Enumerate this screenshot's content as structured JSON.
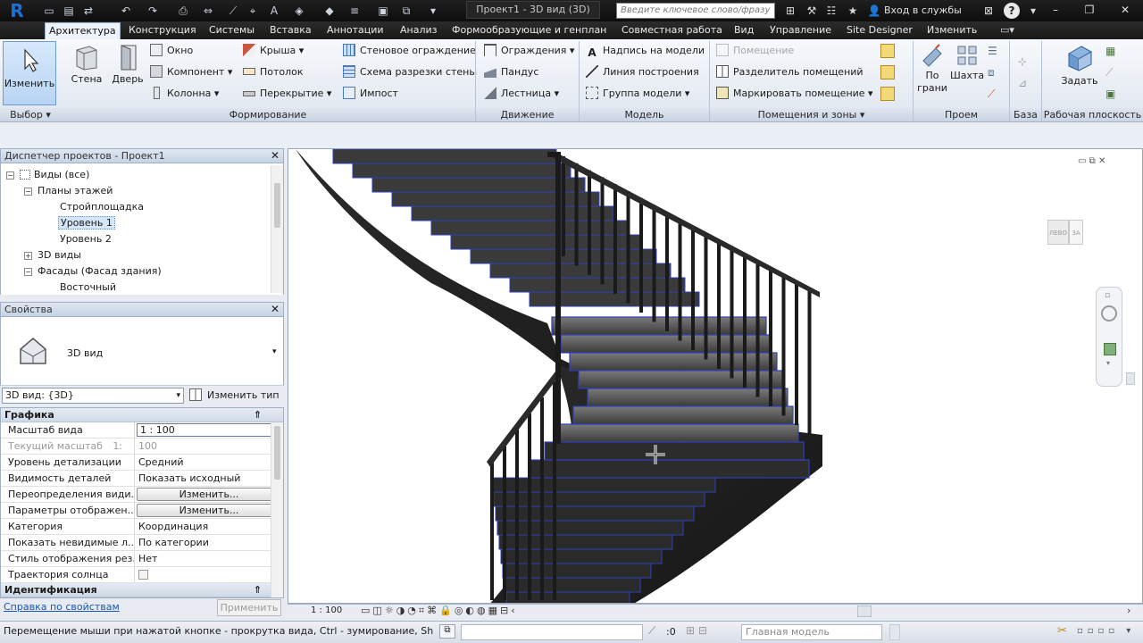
{
  "titlebar": {
    "app_logo": "R",
    "doc_title": "Проект1 - 3D вид (3D)",
    "search_placeholder": "Введите ключевое слово/фразу",
    "signin": "Вход в службы",
    "help": "?"
  },
  "tabs": [
    {
      "label": "Архитектура",
      "active": true
    },
    {
      "label": "Конструкция"
    },
    {
      "label": "Системы"
    },
    {
      "label": "Вставка"
    },
    {
      "label": "Аннотации"
    },
    {
      "label": "Анализ"
    },
    {
      "label": "Формообразующие и генплан"
    },
    {
      "label": "Совместная работа"
    },
    {
      "label": "Вид"
    },
    {
      "label": "Управление"
    },
    {
      "label": "Site Designer"
    },
    {
      "label": "Изменить"
    }
  ],
  "ribbon": {
    "modify": "Изменить",
    "wall": "Стена",
    "door": "Дверь",
    "window": "Окно",
    "component": "Компонент",
    "column": "Колонна",
    "roof": "Крыша",
    "ceiling": "Потолок",
    "floor": "Перекрытие",
    "curtain_system": "Стеновое ограждение",
    "curtain_grid": "Схема разрезки стены",
    "mullion": "Импост",
    "railing": "Ограждения",
    "ramp": "Пандус",
    "stair": "Лестница",
    "model_text": "Надпись на модели",
    "model_line": "Линия построения",
    "model_group": "Группа модели",
    "room": "Помещение",
    "room_separator": "Разделитель помещений",
    "tag_room": "Маркировать помещение",
    "by_face": "По\nграни",
    "shaft": "Шахта",
    "set": "Задать",
    "panels": {
      "select": "Выбор",
      "build": "Формирование",
      "circulation": "Движение",
      "model": "Модель",
      "room_area": "Помещения и зоны",
      "opening": "Проем",
      "datum": "База",
      "work_plane": "Рабочая плоскость"
    }
  },
  "project_browser": {
    "title": "Диспетчер проектов - Проект1",
    "items": [
      {
        "label": "Виды (все)"
      },
      {
        "label": "Планы этажей"
      },
      {
        "label": "Стройплощадка"
      },
      {
        "label": "Уровень 1",
        "selected": true
      },
      {
        "label": "Уровень 2"
      },
      {
        "label": "3D виды"
      },
      {
        "label": "Фасады (Фасад здания)"
      },
      {
        "label": "Восточный"
      }
    ]
  },
  "properties": {
    "title": "Свойства",
    "type_name": "3D вид",
    "selector": "3D вид: {3D}",
    "edit_type": "Изменить тип",
    "group_graphics": "Графика",
    "group_identity": "Идентификация",
    "rows": [
      {
        "name": "Масштаб вида",
        "value": "1 : 100"
      },
      {
        "name": "Текущий масштаб",
        "value": "100",
        "dim": true
      },
      {
        "name": "Уровень детализации",
        "value": "Средний"
      },
      {
        "name": "Видимость деталей",
        "value": "Показать исходный"
      },
      {
        "name": "Переопределения види...",
        "value": "Изменить..."
      },
      {
        "name": "Параметры отображен...",
        "value": "Изменить..."
      },
      {
        "name": "Категория",
        "value": "Координация"
      },
      {
        "name": "Показать невидимые л...",
        "value": "По категории"
      },
      {
        "name": "Стиль отображения рез...",
        "value": "Нет"
      },
      {
        "name": "Траектория солнца",
        "value": ""
      }
    ],
    "current_scale_prefix": "1:",
    "help_link": "Справка по свойствам",
    "apply": "Применить"
  },
  "view": {
    "scale": "1 : 100",
    "viewcube_left": "ЛЕВО",
    "viewcube_front": "ЗА"
  },
  "statusbar": {
    "text": "Перемещение мыши при нажатой кнопке - прокрутка вида, Ctrl - зумирование, Shift - вращение",
    "selection_count": ":0",
    "model": "Главная модель"
  },
  "colors": {
    "accent": "#1e6fd1",
    "stair_outline": "#2f3fb8",
    "stair_fill": "#2b2b2b"
  }
}
